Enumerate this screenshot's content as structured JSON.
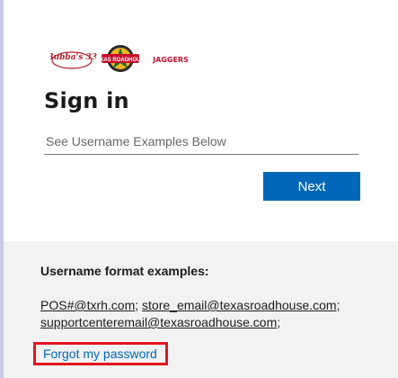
{
  "logos": [
    "Bubba's 33",
    "TEXAS ROADHOUSE",
    "JAGGERS"
  ],
  "signin": {
    "title": "Sign in",
    "username_placeholder": "See Username Examples Below",
    "next_label": "Next"
  },
  "info": {
    "heading": "Username format examples:",
    "example_1": "POS#@txrh.com",
    "sep_1": "; ",
    "example_2": "store_email@texasroadhouse.com",
    "sep_2": ";",
    "example_3": "supportcenteremail@texasroadhouse.com",
    "sep_3": ";",
    "forgot_label": "Forgot my password"
  },
  "colors": {
    "primary": "#0067b8",
    "highlight": "#e3161d",
    "panel": "#f2f2f2"
  }
}
